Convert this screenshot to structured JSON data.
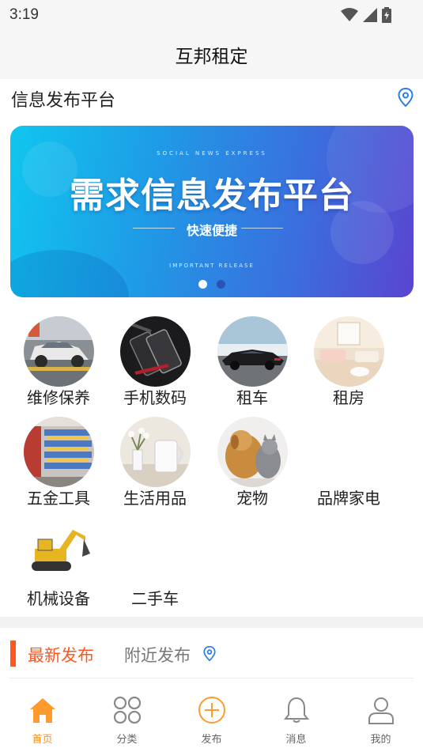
{
  "status_bar": {
    "time": "3:19"
  },
  "header": {
    "title": "互邦租定"
  },
  "platform": {
    "title": "信息发布平台"
  },
  "banner": {
    "top_text": "SOCIAL NEWS EXPRESS",
    "main_text": "需求信息发布平台",
    "sub_text": "快速便捷",
    "bottom_text": "IMPORTANT RELEASE",
    "slide_count": 2,
    "active_slide": 1
  },
  "categories": [
    {
      "label": "维修保养",
      "icon": "car-repair-photo"
    },
    {
      "label": "手机数码",
      "icon": "phones-photo"
    },
    {
      "label": "租车",
      "icon": "sports-car-photo"
    },
    {
      "label": "租房",
      "icon": "room-photo"
    },
    {
      "label": "五金工具",
      "icon": "hardware-store-photo"
    },
    {
      "label": "生活用品",
      "icon": "kettle-photo"
    },
    {
      "label": "宠物",
      "icon": "pets-photo"
    },
    {
      "label": "品牌家电",
      "icon": ""
    },
    {
      "label": "机械设备",
      "icon": "excavator-photo"
    },
    {
      "label": "二手车",
      "icon": ""
    }
  ],
  "tabs": {
    "latest": "最新发布",
    "nearby": "附近发布"
  },
  "bottom_nav": [
    {
      "label": "首页",
      "icon": "home-icon",
      "active": true
    },
    {
      "label": "分类",
      "icon": "grid-icon",
      "active": false
    },
    {
      "label": "发布",
      "icon": "add-circle-icon",
      "active": false
    },
    {
      "label": "消息",
      "icon": "bell-icon",
      "active": false
    },
    {
      "label": "我的",
      "icon": "user-icon",
      "active": false
    }
  ],
  "colors": {
    "accent": "#ff5722",
    "nav_active": "#ff8c1a",
    "location_blue": "#2b7de9"
  }
}
